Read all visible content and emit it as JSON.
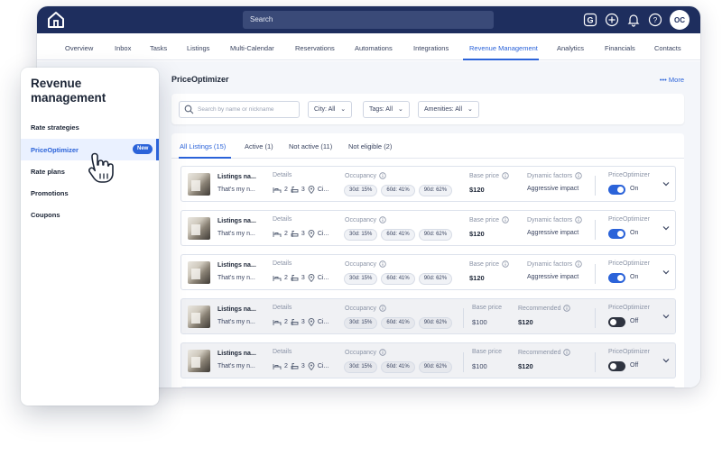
{
  "topbar": {
    "search_label": "Search",
    "avatar_initials": "OC",
    "icons": [
      "home-logo",
      "guesty-g-icon",
      "plus-circle-icon",
      "bell-icon",
      "help-icon"
    ]
  },
  "nav": {
    "items": [
      "Overview",
      "Inbox",
      "Tasks",
      "Listings",
      "Multi-Calendar",
      "Reservations",
      "Automations",
      "Integrations",
      "Revenue Management",
      "Analytics",
      "Financials",
      "Contacts"
    ],
    "active": "Revenue Management"
  },
  "page": {
    "title": "PriceOptimizer",
    "more_label": "More",
    "more_prefix": "•••"
  },
  "filters": {
    "search_placeholder": "Search by name or nickname",
    "city_label": "City:",
    "city_value": "All",
    "tags_label": "Tags:",
    "tags_value": "All",
    "amenities_label": "Amenities:",
    "amenities_value": "All"
  },
  "tabs": [
    "All Listings (15)",
    "Active (1)",
    "Not active (11)",
    "Not eligible (2)"
  ],
  "columns": {
    "details": "Details",
    "occupancy": "Occupancy",
    "base_price": "Base price",
    "dynamic_factors": "Dynamic factors",
    "recommended": "Recommended",
    "price_optimizer": "PriceOptimizer"
  },
  "rows": [
    {
      "name": "Listings na...",
      "desc": "That's my n...",
      "beds": "2",
      "baths": "3",
      "city": "Ci...",
      "occ": [
        "30d: 15%",
        "60d: 41%",
        "90d: 62%"
      ],
      "base": "$120",
      "factor": "Aggressive impact",
      "toggle": "On"
    },
    {
      "name": "Listings na...",
      "desc": "That's my n...",
      "beds": "2",
      "baths": "3",
      "city": "Ci...",
      "occ": [
        "30d: 15%",
        "60d: 41%",
        "90d: 62%"
      ],
      "base": "$120",
      "factor": "Aggressive impact",
      "toggle": "On"
    },
    {
      "name": "Listings na...",
      "desc": "That's my n...",
      "beds": "2",
      "baths": "3",
      "city": "Ci...",
      "occ": [
        "30d: 15%",
        "60d: 41%",
        "90d: 62%"
      ],
      "base": "$120",
      "factor": "Aggressive impact",
      "toggle": "On"
    },
    {
      "name": "Listings na...",
      "desc": "That's my n...",
      "beds": "2",
      "baths": "3",
      "city": "Ci...",
      "occ": [
        "30d: 15%",
        "60d: 41%",
        "90d: 62%"
      ],
      "base": "$100",
      "recommended": "$120",
      "toggle": "Off"
    },
    {
      "name": "Listings na...",
      "desc": "That's my n...",
      "beds": "2",
      "baths": "3",
      "city": "Ci...",
      "occ": [
        "30d: 15%",
        "60d: 41%",
        "90d: 62%"
      ],
      "base": "$100",
      "recommended": "$120",
      "toggle": "Off"
    }
  ],
  "sidebar": {
    "title": "Revenue management",
    "items": [
      "Rate strategies",
      "PriceOptimizer",
      "Rate plans",
      "Promotions",
      "Coupons"
    ],
    "active": "PriceOptimizer",
    "new_badge": "New"
  },
  "colors": {
    "topbar": "#1e2e5e",
    "accent": "#2b63d9",
    "toggle_off": "#2f3440"
  }
}
